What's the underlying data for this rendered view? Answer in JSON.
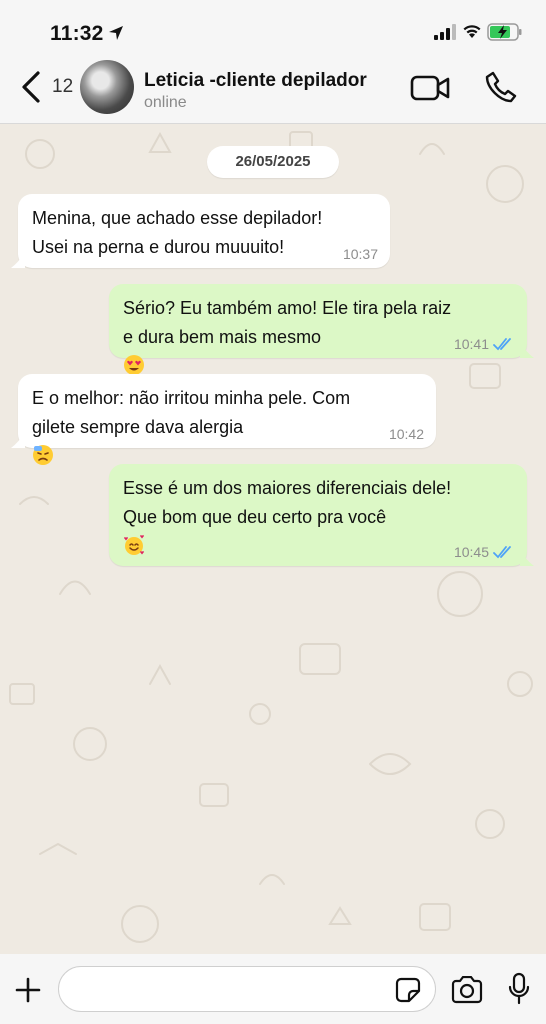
{
  "status_bar": {
    "time": "11:32"
  },
  "header": {
    "back_count": "12",
    "contact_name": "Leticia -cliente depilador",
    "contact_status": "online"
  },
  "chat": {
    "date_chip": "26/05/2025",
    "messages": [
      {
        "direction": "in",
        "text": "Menina, que achado esse depilador!\nUsei na perna e durou muuuito!",
        "time": "10:37"
      },
      {
        "direction": "out",
        "text": "Sério? Eu também amo! Ele tira pela raiz\ne dura bem mais mesmo",
        "emoji": "heart-eyes-emoji",
        "time": "10:41",
        "status": "read"
      },
      {
        "direction": "in",
        "text": "E o melhor: não irritou minha pele. Com\ngilete sempre dava alergia",
        "emoji": "sick-face-emoji",
        "time": "10:42"
      },
      {
        "direction": "out",
        "text": "Esse é um dos maiores diferenciais dele!\nQue bom que deu certo pra você",
        "emoji": "smiling-face-with-hearts-emoji",
        "time": "10:45",
        "status": "read"
      }
    ]
  },
  "colors": {
    "incoming_bubble": "#ffffff",
    "outgoing_bubble": "#dcf8c6",
    "chat_background": "#efeae2",
    "read_ticks": "#4fa3f7"
  }
}
